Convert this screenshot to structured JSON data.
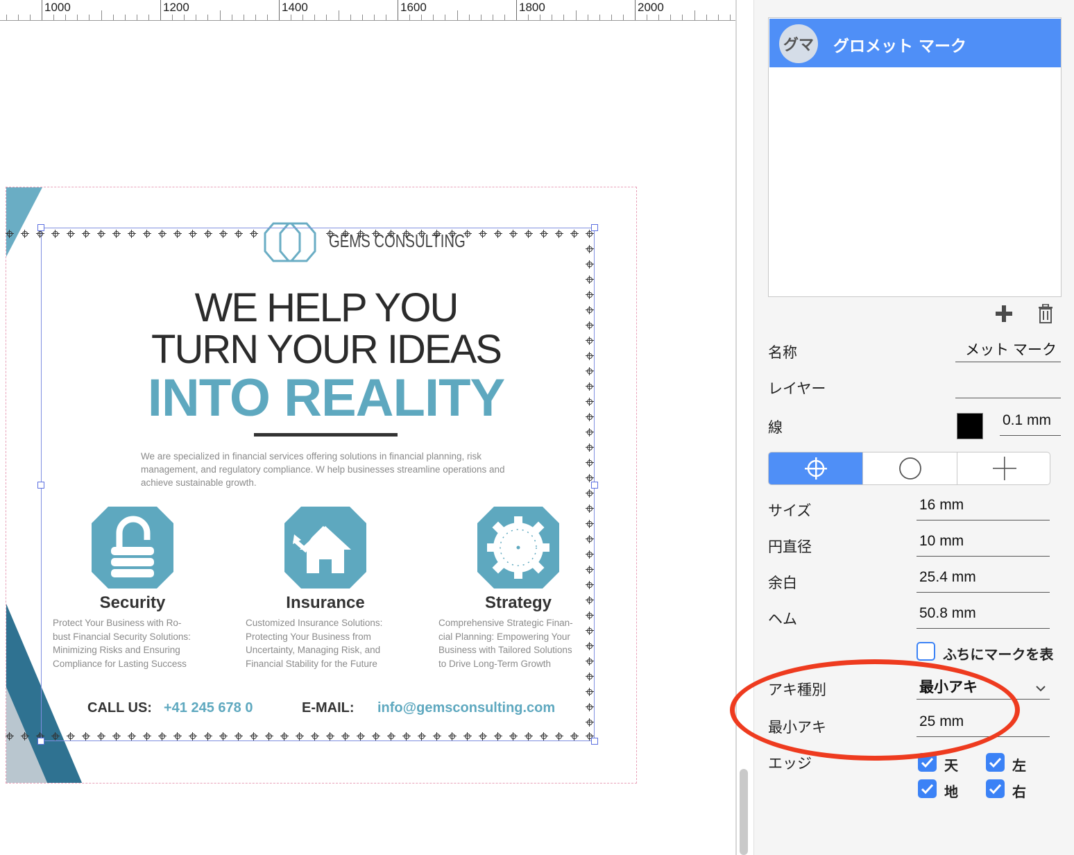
{
  "ruler": {
    "labels": [
      "1000",
      "1200",
      "1400",
      "1600",
      "1800",
      "2000"
    ]
  },
  "flyer": {
    "logo_text": "GEMS CONSULTING",
    "headline_1": "WE HELP YOU",
    "headline_2": "TURN YOUR IDEAS",
    "headline_3": "INTO REALITY",
    "intro": "We are specialized in financial services offering solutions in financial planning, risk management, and regulatory compliance. W help businesses streamline operations and achieve sustainable growth.",
    "services": [
      {
        "title": "Security",
        "desc": "Protect Your Business with Ro-\nbust Financial Security Solutions:\nMinimizing Risks and Ensuring\nCompliance for Lasting Success"
      },
      {
        "title": "Insurance",
        "desc": "Customized Insurance Solutions:\nProtecting Your Business from\nUncertainty, Managing Risk, and\nFinancial Stability for the Future"
      },
      {
        "title": "Strategy",
        "desc": "Comprehensive Strategic Finan-\ncial Planning: Empowering Your\nBusiness with Tailored Solutions\nto Drive Long-Term Growth"
      }
    ],
    "call_label": "CALL US:",
    "call_value": "+41 245 678 0",
    "email_label": "E-MAIL:",
    "email_value": "info@gemsconsulting.com",
    "accent_color": "#5ea8bf"
  },
  "panel": {
    "mark_list": [
      {
        "avatar": "グマ",
        "name": "グロメット マーク",
        "selected": true
      }
    ],
    "add_icon": "plus-icon",
    "delete_icon": "trash-icon",
    "name_label": "名称",
    "name_value": "メット マーク",
    "layer_label": "レイヤー",
    "layer_value": "",
    "stroke_label": "線",
    "stroke_color": "#000000",
    "stroke_width": "0.1 mm",
    "mark_types": [
      "crosshair-circle-icon",
      "circle-icon",
      "plus-thin-icon"
    ],
    "size_label": "サイズ",
    "size_value": "16 mm",
    "circle_label": "円直径",
    "circle_value": "10 mm",
    "margin_label": "余白",
    "margin_value": "25.4 mm",
    "hem_label": "ヘム",
    "hem_value": "50.8 mm",
    "edge_mark_checkbox": "ふちにマークを表",
    "gap_type_label": "アキ種別",
    "gap_type_value": "最小アキ",
    "min_gap_label": "最小アキ",
    "min_gap_value": "25 mm",
    "edges_label": "エッジ",
    "edges": [
      {
        "label": "天",
        "checked": true
      },
      {
        "label": "左",
        "checked": true
      },
      {
        "label": "地",
        "checked": true
      },
      {
        "label": "右",
        "checked": true
      }
    ],
    "accent_color": "#4f8ff7",
    "highlight_color": "#ee3b1f"
  }
}
